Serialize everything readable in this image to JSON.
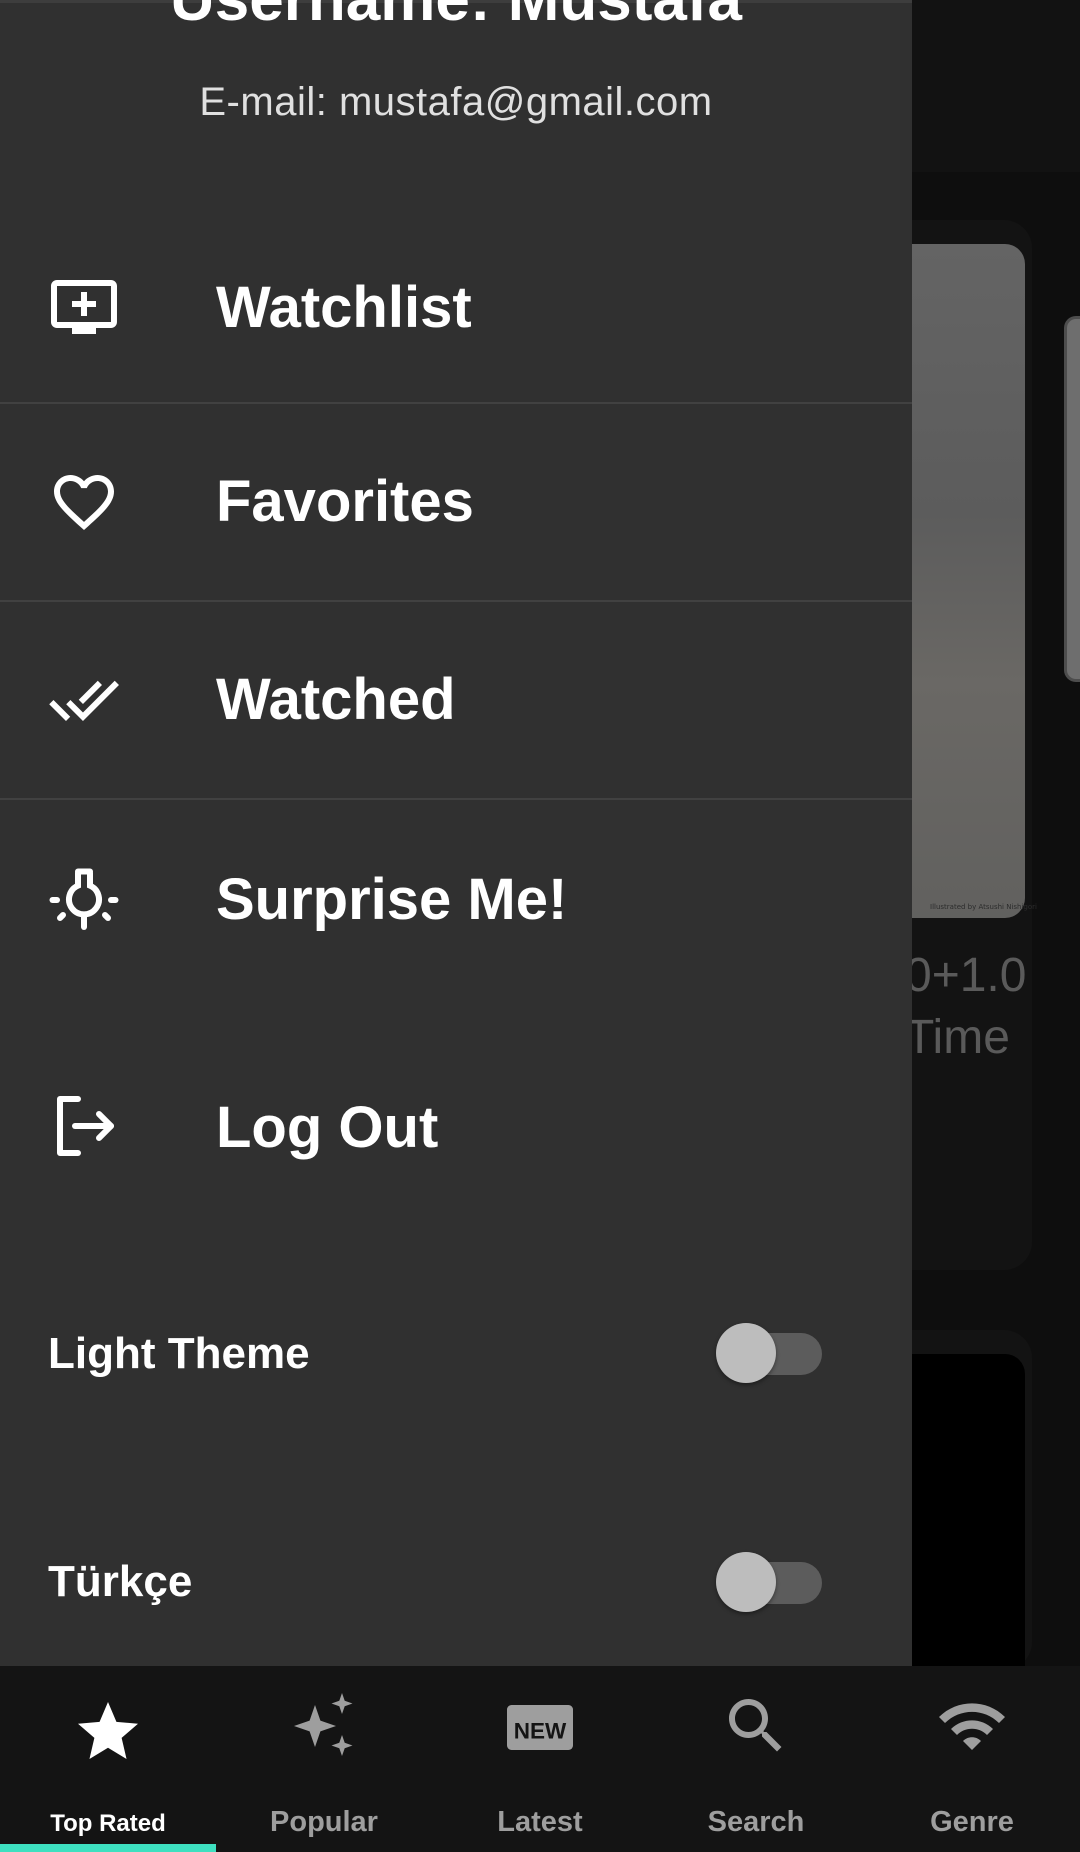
{
  "drawer": {
    "username": "Username: Mustafa",
    "email": "E-mail: mustafa@gmail.com",
    "menu": [
      {
        "label": "Watchlist",
        "icon": "add-to-queue-icon"
      },
      {
        "label": "Favorites",
        "icon": "heart-outline-icon"
      },
      {
        "label": "Watched",
        "icon": "double-check-icon"
      },
      {
        "label": "Surprise Me!",
        "icon": "lightbulb-icon"
      },
      {
        "label": "Log Out",
        "icon": "logout-icon"
      }
    ],
    "toggles": [
      {
        "label": "Light Theme",
        "on": false
      },
      {
        "label": "Türkçe",
        "on": false
      }
    ]
  },
  "background": {
    "card_text_line1": "0+1.0",
    "card_text_line2": "Time",
    "poster_credit": "Illustrated by Atsushi Nishigori"
  },
  "bottom_nav": {
    "items": [
      {
        "label": "Top Rated",
        "icon": "star-icon",
        "active": true
      },
      {
        "label": "Popular",
        "icon": "sparkle-icon",
        "active": false
      },
      {
        "label": "Latest",
        "icon": "new-badge-icon",
        "active": false
      },
      {
        "label": "Search",
        "icon": "search-icon",
        "active": false
      },
      {
        "label": "Genre",
        "icon": "wifi-icon",
        "active": false
      }
    ],
    "indicator_color": "#3ee0c0"
  },
  "colors": {
    "drawer_bg": "#303030",
    "nav_bg": "#141414",
    "text_primary": "#ffffff",
    "text_inactive": "#9e9e9e"
  }
}
